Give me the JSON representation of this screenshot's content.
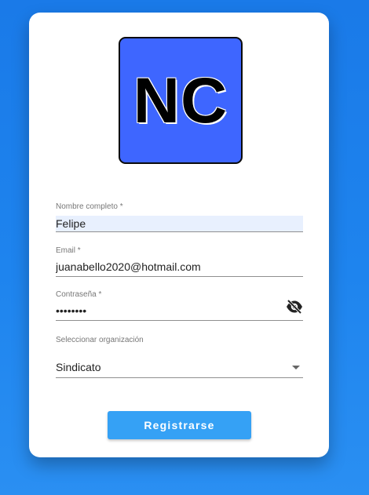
{
  "logo": {
    "text": "NC",
    "background_color": "#3e66ff"
  },
  "form": {
    "full_name": {
      "label": "Nombre completo *",
      "value": "Felipe"
    },
    "email": {
      "label": "Email *",
      "value": "juanabello2020@hotmail.com"
    },
    "password": {
      "label": "Contraseña *",
      "value": "••••••••",
      "visibility_icon": "eye-off-icon"
    },
    "organization": {
      "label": "Seleccionar organización",
      "selected": "Sindicato",
      "dropdown_icon": "chevron-down-icon"
    },
    "submit_label": "Registrarse"
  },
  "colors": {
    "page_background": "#1e84ee",
    "button": "#35a1f5",
    "autofill": "#e8f0fe"
  }
}
